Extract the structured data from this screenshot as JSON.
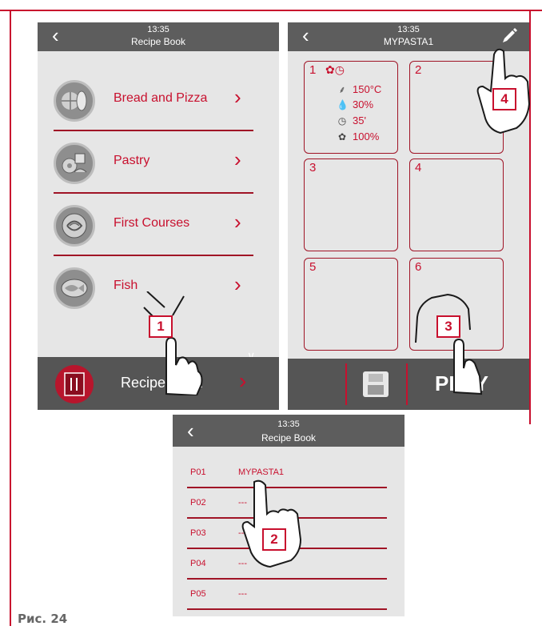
{
  "figure_label": "Рис. 24",
  "panel_a": {
    "time": "13:35",
    "title": "Recipe Book",
    "categories": [
      {
        "label": "Bread and Pizza",
        "icon": "bread-pizza-icon"
      },
      {
        "label": "Pastry",
        "icon": "pastry-icon"
      },
      {
        "label": "First Courses",
        "icon": "first-courses-icon"
      },
      {
        "label": "Fish",
        "icon": "fish-icon"
      }
    ],
    "footer_label": "Recipe Book"
  },
  "panel_b": {
    "time": "13:35",
    "title": "MYPASTA1",
    "steps": [
      {
        "num": "1",
        "temp": "150°C",
        "humidity": "30%",
        "time": "35'",
        "fan": "100%"
      },
      {
        "num": "2"
      },
      {
        "num": "3"
      },
      {
        "num": "4"
      },
      {
        "num": "5"
      },
      {
        "num": "6"
      }
    ],
    "play_label": "PLAY"
  },
  "panel_c": {
    "time": "13:35",
    "title": "Recipe Book",
    "programs": [
      {
        "code": "P01",
        "name": "MYPASTA1"
      },
      {
        "code": "P02",
        "name": "---"
      },
      {
        "code": "P03",
        "name": "---"
      },
      {
        "code": "P04",
        "name": "---"
      },
      {
        "code": "P05",
        "name": "---"
      }
    ]
  },
  "callouts": [
    "1",
    "2",
    "3",
    "4"
  ],
  "colors": {
    "accent": "#c8102e",
    "header": "#5d5d5d",
    "panel_bg": "#e6e6e6",
    "footer": "#555555"
  }
}
